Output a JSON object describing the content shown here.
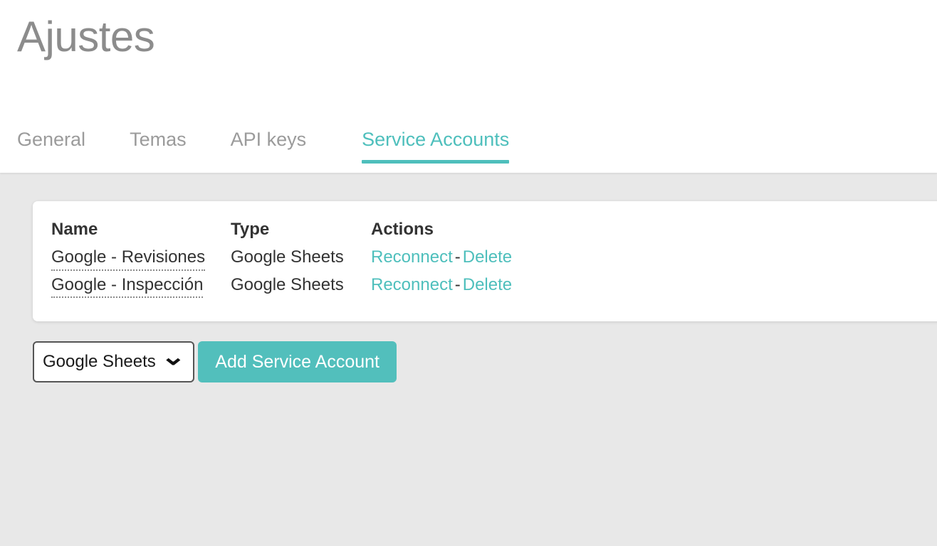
{
  "header": {
    "title": "Ajustes"
  },
  "tabs": [
    {
      "label": "General",
      "active": false
    },
    {
      "label": "Temas",
      "active": false
    },
    {
      "label": "API keys",
      "active": false
    },
    {
      "label": "Service Accounts",
      "active": true
    }
  ],
  "table": {
    "columns": {
      "name": "Name",
      "type": "Type",
      "actions": "Actions"
    },
    "rows": [
      {
        "name": "Google - Revisiones",
        "type": "Google Sheets",
        "reconnect": "Reconnect",
        "separator": "-",
        "delete": "Delete"
      },
      {
        "name": "Google - Inspección",
        "type": "Google Sheets",
        "reconnect": "Reconnect",
        "separator": "-",
        "delete": "Delete"
      }
    ]
  },
  "controls": {
    "service_type_selected": "Google Sheets",
    "chevron_icon": "⌄",
    "add_button_label": "Add Service Account"
  },
  "colors": {
    "accent_teal": "#4ebfbc",
    "button_teal": "#52bfbc",
    "title_gray": "#8c8c8c",
    "tab_inactive_gray": "#9b9b9b",
    "text_dark": "#333333",
    "page_background": "#e8e8e8",
    "card_background": "#ffffff",
    "select_border": "#555555"
  }
}
